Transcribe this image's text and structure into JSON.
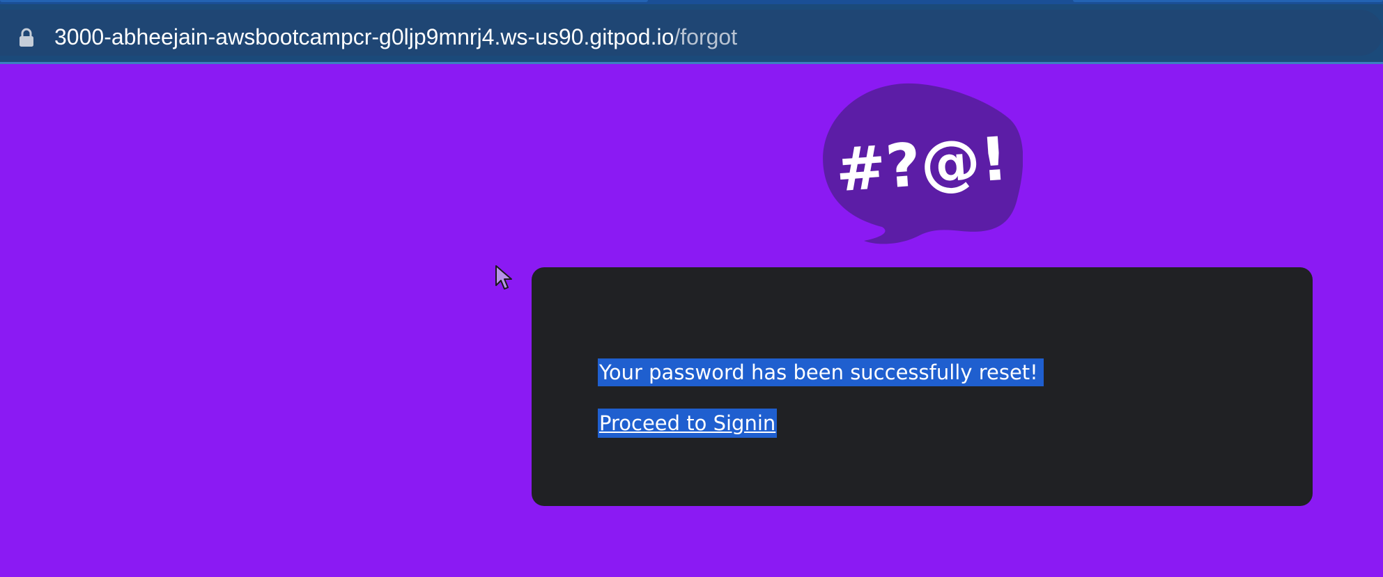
{
  "browser": {
    "url_host": "3000-abheejain-awsbootcampcr-g0ljp9mnrj4.ws-us90.gitpod.io",
    "url_path": "/forgot",
    "lock_icon": "lock-icon"
  },
  "page": {
    "logo_icon": "speech-bubble-symbols-logo",
    "logo_text": "#?@!",
    "success_message": "Your password has been successfully reset!",
    "signin_link_label": "Proceed to Signin"
  },
  "colors": {
    "page_background": "#8b1af3",
    "card_background": "#202124",
    "logo_bubble": "#5c1da6",
    "text_selection": "#1f5fcf"
  }
}
